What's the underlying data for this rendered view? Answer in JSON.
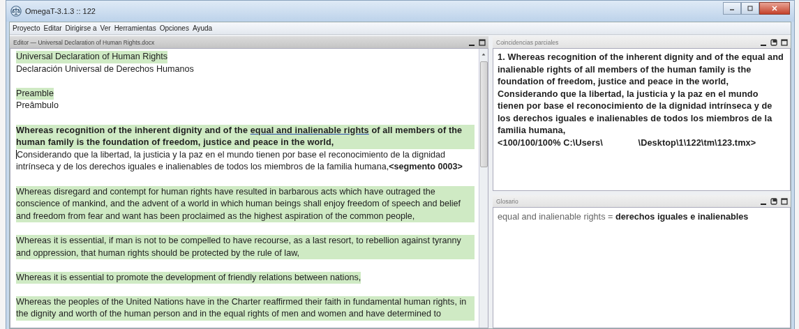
{
  "window": {
    "title": "OmegaT-3.1.3 :: 122"
  },
  "menu": [
    "Proyecto",
    "Editar",
    "Dirigirse a",
    "Ver",
    "Herramientas",
    "Opciones",
    "Ayuda"
  ],
  "editor": {
    "title": "Editor — Universal Declaration of Human Rights.docx",
    "segments": [
      {
        "active": false,
        "source": [
          {
            "text": "Universal Declaration of Human Rights",
            "glossary": false
          }
        ],
        "target": "Declaración Universal de Derechos Humanos"
      },
      {
        "active": false,
        "source": [
          {
            "text": "Preamble",
            "glossary": false
          }
        ],
        "target": "Preâmbulo"
      },
      {
        "active": true,
        "source": [
          {
            "text": "Whereas recognition of the inherent dignity and of the ",
            "glossary": false
          },
          {
            "text": "equal and inalienable rights",
            "glossary": true
          },
          {
            "text": " of all members of the human family is the foundation of freedom, justice and peace in the world,",
            "glossary": false
          }
        ],
        "target": "Considerando que la libertad, la justicia y la paz en el mundo tienen por base el reconocimiento de la dignidad intrínseca y de los derechos iguales e inalienables de todos los miembros de la familia humana,**<segmento 0003>**"
      },
      {
        "active": false,
        "source": [
          {
            "text": "Whereas disregard and contempt for human rights have resulted in barbarous acts which have outraged the conscience of mankind, and the advent of a world in which human beings shall enjoy freedom of speech and belief and freedom from fear and want has been proclaimed as the highest aspiration of the common people,",
            "glossary": false
          }
        ]
      },
      {
        "active": false,
        "source": [
          {
            "text": "Whereas it is essential, if man is not to be compelled to have recourse, as a last resort, to rebellion against tyranny and oppression, that human rights should be protected by the rule of law,",
            "glossary": false
          }
        ]
      },
      {
        "active": false,
        "source": [
          {
            "text": "Whereas it is essential to promote the development of friendly relations between nations,",
            "glossary": false
          }
        ]
      },
      {
        "active": false,
        "source": [
          {
            "text": "Whereas the peoples of the United Nations have in the Charter reaffirmed their faith in fundamental human rights, in the dignity and worth of the human person and in the equal rights of men and women and have determined to",
            "glossary": false
          }
        ]
      }
    ]
  },
  "matches": {
    "title": "Coincidencias parciales",
    "text": "1. Whereas recognition of the inherent dignity and of the equal and inalienable rights of all members of the human family is the foundation of freedom, justice and peace in the world,\nConsiderando que la libertad, la justicia y la paz en el mundo tienen por base el reconocimiento de la dignidad intrínseca y de los derechos iguales e inalienables de todos los miembros de la familia humana,\n<100/100/100% C:\\Users\\              \\Desktop\\1\\122\\tm\\123.tmx>"
  },
  "glossary": {
    "title": "Glosario",
    "entries": [
      "equal and inalienable rights = **derechos iguales e inalienables**"
    ]
  }
}
